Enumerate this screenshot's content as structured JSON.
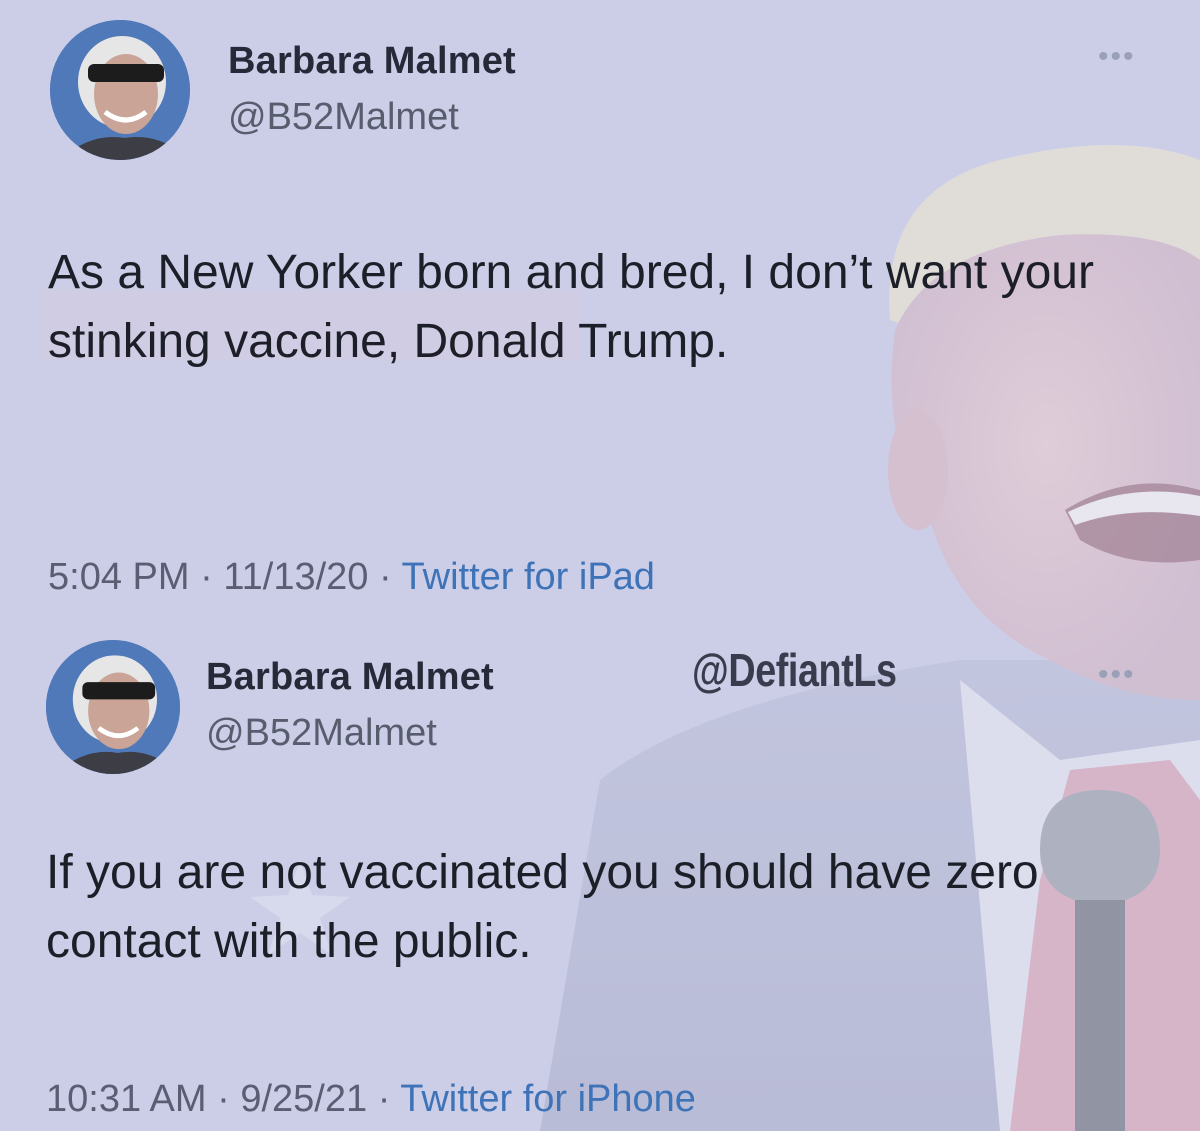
{
  "tweets": [
    {
      "display_name": "Barbara Malmet",
      "handle": "@B52Malmet",
      "more_label": "•••",
      "text": "As a New Yorker born and bred, I don’t want your stinking vaccine, Donald Trump.",
      "time": "5:04 PM",
      "separator": " · ",
      "date": "11/13/20",
      "source": "Twitter for iPad"
    },
    {
      "display_name": "Barbara Malmet",
      "handle": "@B52Malmet",
      "more_label": "•••",
      "text": "If you are not vaccinated you should have zero contact with the public.",
      "time": "10:31 AM",
      "separator": " · ",
      "date": "9/25/21",
      "source": "Twitter for iPhone"
    }
  ],
  "watermark": "@DefiantLs",
  "colors": {
    "background": "#c9cbe6",
    "source_link": "#3e73b8",
    "name": "#262a38",
    "handle": "#585d6e"
  },
  "icons": {
    "more": "more-dots-icon",
    "avatar": "profile-avatar"
  }
}
